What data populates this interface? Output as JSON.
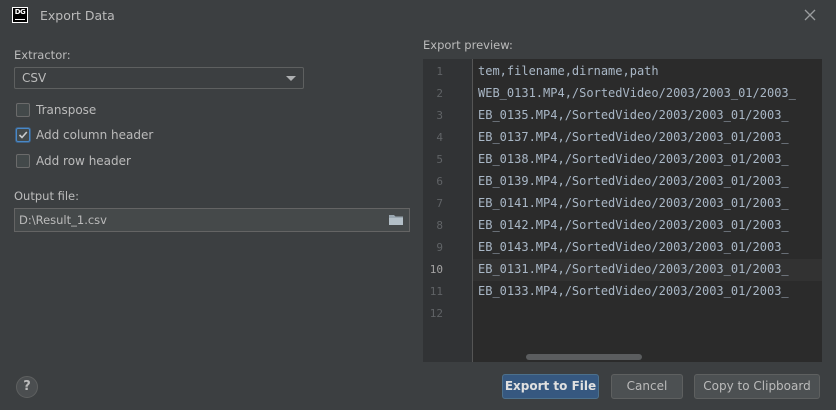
{
  "window": {
    "title": "Export Data",
    "logo_text": "DG"
  },
  "extractor": {
    "label": "Extractor:",
    "value": "CSV"
  },
  "options": {
    "transpose": {
      "label": "Transpose",
      "checked": false
    },
    "add_column_header": {
      "label": "Add column header",
      "checked": true
    },
    "add_row_header": {
      "label": "Add row header",
      "checked": false
    }
  },
  "output": {
    "label": "Output file:",
    "value": "D:\\Result_1.csv"
  },
  "preview": {
    "label": "Export preview:",
    "current_line": 10,
    "lines": [
      {
        "n": "1",
        "text": "tem,filename,dirname,path"
      },
      {
        "n": "2",
        "text": "WEB_0131.MP4,/SortedVideo/2003/2003_01/2003_"
      },
      {
        "n": "3",
        "text": "EB_0135.MP4,/SortedVideo/2003/2003_01/2003_"
      },
      {
        "n": "4",
        "text": "EB_0137.MP4,/SortedVideo/2003/2003_01/2003_"
      },
      {
        "n": "5",
        "text": "EB_0138.MP4,/SortedVideo/2003/2003_01/2003_"
      },
      {
        "n": "6",
        "text": "EB_0139.MP4,/SortedVideo/2003/2003_01/2003_"
      },
      {
        "n": "7",
        "text": "EB_0141.MP4,/SortedVideo/2003/2003_01/2003_"
      },
      {
        "n": "8",
        "text": "EB_0142.MP4,/SortedVideo/2003/2003_01/2003_"
      },
      {
        "n": "9",
        "text": "EB_0143.MP4,/SortedVideo/2003/2003_01/2003_"
      },
      {
        "n": "10",
        "text": "EB_0131.MP4,/SortedVideo/2003/2003_01/2003_"
      },
      {
        "n": "11",
        "text": "EB_0133.MP4,/SortedVideo/2003/2003_01/2003_"
      },
      {
        "n": "12",
        "text": ""
      }
    ]
  },
  "buttons": {
    "help": "?",
    "export": "Export to File",
    "cancel": "Cancel",
    "copy": "Copy to Clipboard"
  },
  "icons": {
    "close": "close-icon",
    "dropdown": "chevron-down-icon",
    "folder": "folder-icon",
    "checkmark": "checkmark-icon"
  },
  "colors": {
    "background": "#3c3f41",
    "editor_background": "#2b2b2b",
    "primary_button": "#365880",
    "checkbox_accent": "#4a88c7"
  }
}
